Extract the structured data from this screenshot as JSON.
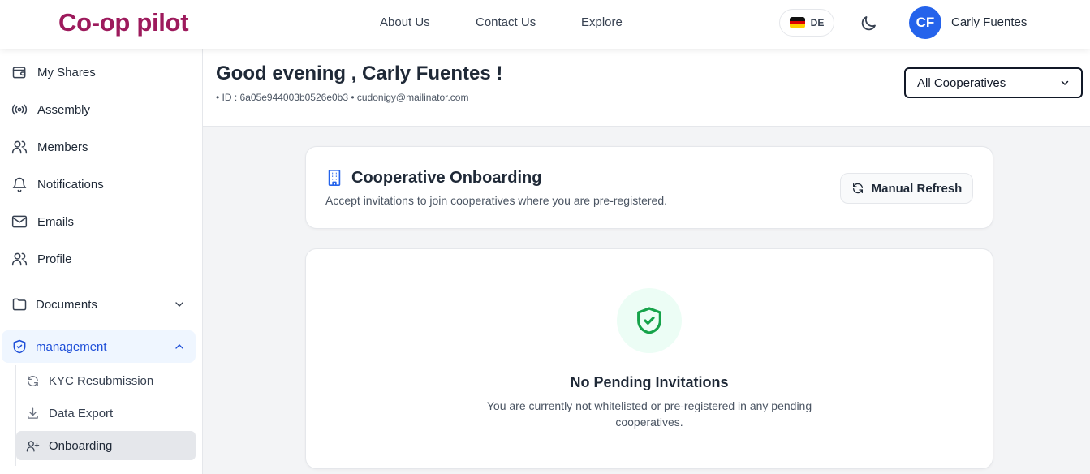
{
  "header": {
    "brand": "Co-op pilot",
    "nav": [
      "About Us",
      "Contact Us",
      "Explore"
    ],
    "language": "DE",
    "avatar_initials": "CF",
    "user_name": "Carly Fuentes"
  },
  "sidebar": {
    "items": [
      {
        "label": "My Shares",
        "icon": "wallet-icon"
      },
      {
        "label": "Assembly",
        "icon": "broadcast-icon"
      },
      {
        "label": "Members",
        "icon": "users-icon"
      },
      {
        "label": "Notifications",
        "icon": "bell-icon"
      },
      {
        "label": "Emails",
        "icon": "mail-icon"
      },
      {
        "label": "Profile",
        "icon": "users-icon"
      }
    ],
    "documents_label": "Documents",
    "management_label": "management",
    "sub_items": [
      {
        "label": "KYC Resubmission",
        "icon": "refresh-icon"
      },
      {
        "label": "Data Export",
        "icon": "download-icon"
      },
      {
        "label": "Onboarding",
        "icon": "user-plus-icon"
      }
    ]
  },
  "greeting": {
    "title": "Good evening , Carly Fuentes !",
    "meta": "• ID : 6a05e944003b0526e0b3 • cudonigy@mailinator.com",
    "select_value": "All Cooperatives"
  },
  "onboarding": {
    "title": "Cooperative Onboarding",
    "subtitle": "Accept invitations to join cooperatives where you are pre-registered.",
    "refresh_label": "Manual Refresh"
  },
  "empty_state": {
    "title": "No Pending Invitations",
    "text": "You are currently not whitelisted or pre-registered in any pending cooperatives."
  },
  "colors": {
    "brand": "#9d1a5c",
    "accent": "#2563eb",
    "success": "#16a34a"
  }
}
